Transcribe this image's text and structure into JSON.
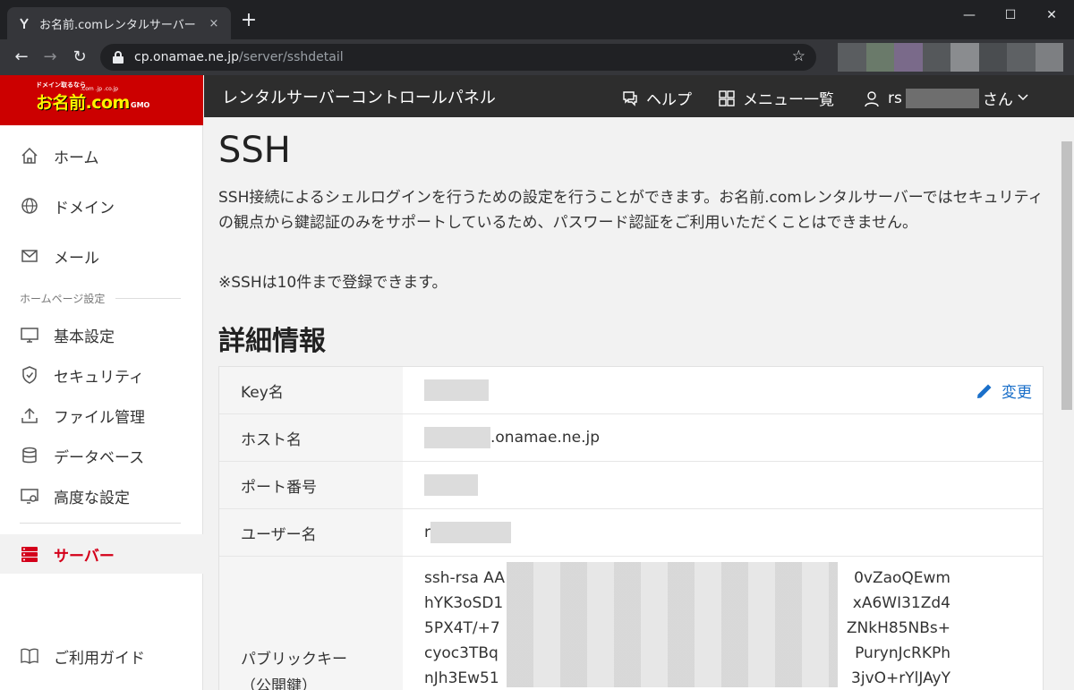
{
  "browser": {
    "tab_title": "お名前.comレンタルサーバー コントロー",
    "tab_close": "×",
    "new_tab": "+",
    "url_host": "cp.onamae.ne.jp",
    "url_path": "/server/sshdetail",
    "window_controls": {
      "minimize": "—",
      "maximize": "☐",
      "close": "✕"
    }
  },
  "logo": {
    "tagline": "ドメイン取るなら",
    "brand": "お名前.com",
    "tlds": ".com .jp .co.jp",
    "company": "GMO"
  },
  "sidebar": {
    "items_top": [
      {
        "label": "ホーム",
        "icon": "home-icon"
      },
      {
        "label": "ドメイン",
        "icon": "globe-icon"
      },
      {
        "label": "メール",
        "icon": "mail-icon"
      }
    ],
    "section_label": "ホームページ設定",
    "items_hp": [
      {
        "label": "基本設定",
        "icon": "monitor-icon"
      },
      {
        "label": "セキュリティ",
        "icon": "shield-icon"
      },
      {
        "label": "ファイル管理",
        "icon": "upload-icon"
      },
      {
        "label": "データベース",
        "icon": "database-icon"
      },
      {
        "label": "高度な設定",
        "icon": "settings-monitor-icon"
      }
    ],
    "server": {
      "label": "サーバー",
      "icon": "server-icon",
      "active_color": "#d4001a"
    },
    "guide": {
      "label": "ご利用ガイド",
      "icon": "book-icon"
    }
  },
  "header": {
    "title": "レンタルサーバーコントロールパネル",
    "help": "ヘルプ",
    "menu": "メニュー一覧",
    "user_prefix": "rs",
    "user_suffix": "さん"
  },
  "main": {
    "title": "SSH",
    "description": "SSH接続によるシェルログインを行うための設定を行うことができます。お名前.comレンタルサーバーではセキュリティの観点から鍵認証のみをサポートしているため、パスワード認証をご利用いただくことはできません。",
    "note": "※SSHは10件まで登録できます。",
    "section_title": "詳細情報",
    "edit_label": "変更",
    "rows": {
      "key_name": "Key名",
      "host_name": "ホスト名",
      "host_value": ".onamae.ne.jp",
      "port": "ポート番号",
      "user_name": "ユーザー名",
      "user_value_prefix": "r",
      "public_key_1": "パブリックキー",
      "public_key_2": "（公開鍵）"
    },
    "key_lines": [
      {
        "left": "ssh-rsa AA",
        "right": "0vZaoQEwm"
      },
      {
        "left": "hYK3oSD1",
        "right": "xA6WI31Zd4"
      },
      {
        "left": "5PX4T/+7",
        "right": "ZNkH85NBs+"
      },
      {
        "left": "cyoc3TBq",
        "right": "PurynJcRKPh"
      },
      {
        "left": "nJh3Ew51",
        "right": "3jvO+rYlJAyY"
      }
    ]
  },
  "colors": {
    "brand_red": "#cc0000",
    "active_red": "#d4001a",
    "link_blue": "#1a6fc9",
    "header_bg": "#2d2d2d"
  }
}
